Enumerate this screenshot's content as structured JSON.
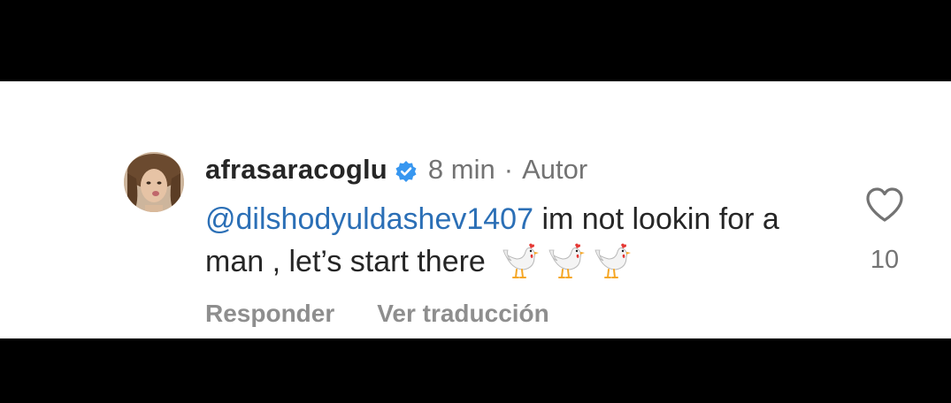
{
  "comment": {
    "username": "afrasaracoglu",
    "time": "8 min",
    "separator": "·",
    "role": "Autor",
    "mention": "@dilshodyuldashev1407",
    "text": " im not lookin for a man , let’s start there",
    "emoji": [
      "chicken-icon",
      "chicken-icon",
      "chicken-icon"
    ],
    "verified_icon": "verified-badge-icon",
    "avatar": "user-avatar"
  },
  "actions": {
    "reply_label": "Responder",
    "translate_label": "Ver traducción"
  },
  "like": {
    "icon": "heart-outline-icon",
    "count": "10"
  },
  "colors": {
    "mention": "#2b6fb6",
    "verified": "#3897f0",
    "muted": "#737373",
    "text": "#262626"
  }
}
